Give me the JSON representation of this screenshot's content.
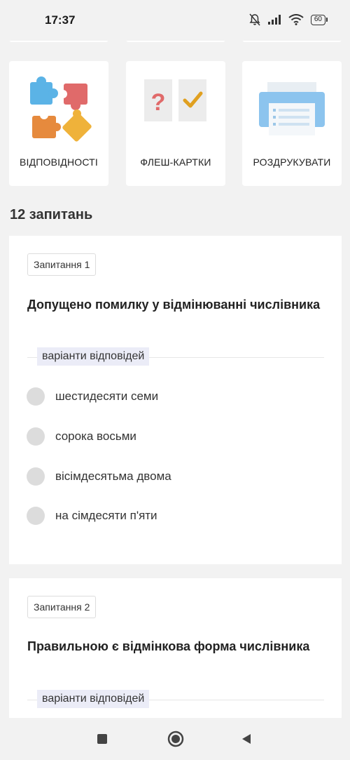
{
  "status_bar": {
    "time": "17:37",
    "battery": "60",
    "icons": [
      "mute-icon",
      "signal-icon",
      "wifi-icon",
      "battery-icon"
    ]
  },
  "tools": [
    {
      "label": "ВІДПОВІДНОСТІ",
      "icon": "puzzle-icon"
    },
    {
      "label": "ФЛЕШ-КАРТКИ",
      "icon": "flashcards-icon"
    },
    {
      "label": "РОЗДРУКУВАТИ",
      "icon": "printer-icon"
    }
  ],
  "questions_count": "12 запитань",
  "questions": [
    {
      "badge": "Запитання 1",
      "text": "Допущено помилку у відмінюванні числівника",
      "options_label": "варіанти відповідей",
      "options": [
        "шестидесяти семи",
        "сорока восьми",
        "вісімдесятьма двома",
        "на сімдесяти п'яти"
      ]
    },
    {
      "badge": "Запитання 2",
      "text": "Правильною є відмінкова форма числівника",
      "options_label": "варіанти відповідей"
    }
  ],
  "colors": {
    "background": "#f2f2f2",
    "card": "#ffffff",
    "options_label_bg": "#ebecf7",
    "radio": "#dcdcdc",
    "puzzle_blue": "#5bb3e6",
    "puzzle_red": "#e06a6a",
    "puzzle_orange": "#e68a3d",
    "puzzle_yellow": "#efb23a",
    "check": "#e0a020",
    "printer": "#8cc4ee"
  },
  "nav": [
    "recent-apps-button",
    "home-button",
    "back-button"
  ]
}
